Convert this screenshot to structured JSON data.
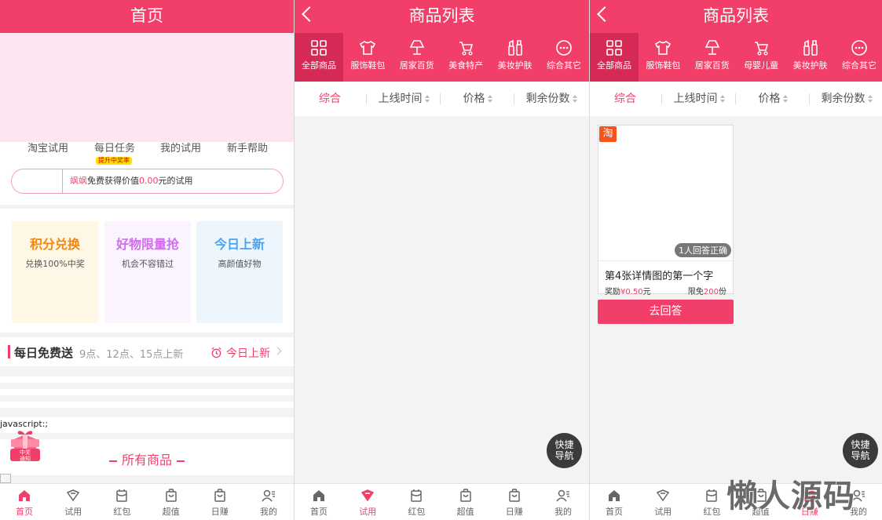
{
  "panel1": {
    "title": "首页",
    "quick_nav": [
      "淘宝试用",
      "每日任务",
      "我的试用",
      "新手帮助"
    ],
    "task_tag": "提升中奖率",
    "notice": {
      "name": "飒飒",
      "pre": "免费获得价值",
      "amount": "0.00",
      "post": "元的试用"
    },
    "cards": [
      {
        "title": "积分兑换",
        "sub": "兑换100%中奖",
        "color": "#f5860d",
        "bg": "#fff7e6"
      },
      {
        "title": "好物限量抢",
        "sub": "机会不容错过",
        "color": "#d26cf0",
        "bg": "#fbf3fd"
      },
      {
        "title": "今日上新",
        "sub": "高颜值好物",
        "color": "#4aa3f0",
        "bg": "#eef6fd"
      }
    ],
    "daily": {
      "title": "每日免费送",
      "sub": "9点、12点、15点上新",
      "right": "今日上新"
    },
    "js_text": "javascript:;",
    "prize_text": [
      "中奖",
      "通知"
    ],
    "all_products": "所有商品"
  },
  "list_title": "商品列表",
  "categories": [
    "全部商品",
    "服饰鞋包",
    "居家百货",
    "美食特产",
    "美妆护肤",
    "综合其它"
  ],
  "categories_p3": [
    "全部商品",
    "服饰鞋包",
    "居家百货",
    "母婴儿童",
    "美妆护肤",
    "综合其它"
  ],
  "sort": [
    "综合",
    "上线时间",
    "价格",
    "剩余份数"
  ],
  "fab": [
    "快捷",
    "导航"
  ],
  "product": {
    "badge": "淘",
    "answered": "1人回答正确",
    "title": "第4张详情图的第一个字",
    "reward_label": "奖励",
    "reward_value": "¥0.50",
    "reward_unit": "元",
    "limit_label": "限免",
    "limit_value": "200",
    "limit_unit": "份",
    "button": "去回答"
  },
  "tabs": [
    "首页",
    "试用",
    "红包",
    "超值",
    "日赚",
    "我的"
  ],
  "active_tab": {
    "panel1": "首页",
    "panel2": "试用",
    "panel3": "日赚"
  },
  "watermark": "懒人源码",
  "colors": {
    "accent": "#f23f6a",
    "accent_dark": "#d42a55"
  }
}
